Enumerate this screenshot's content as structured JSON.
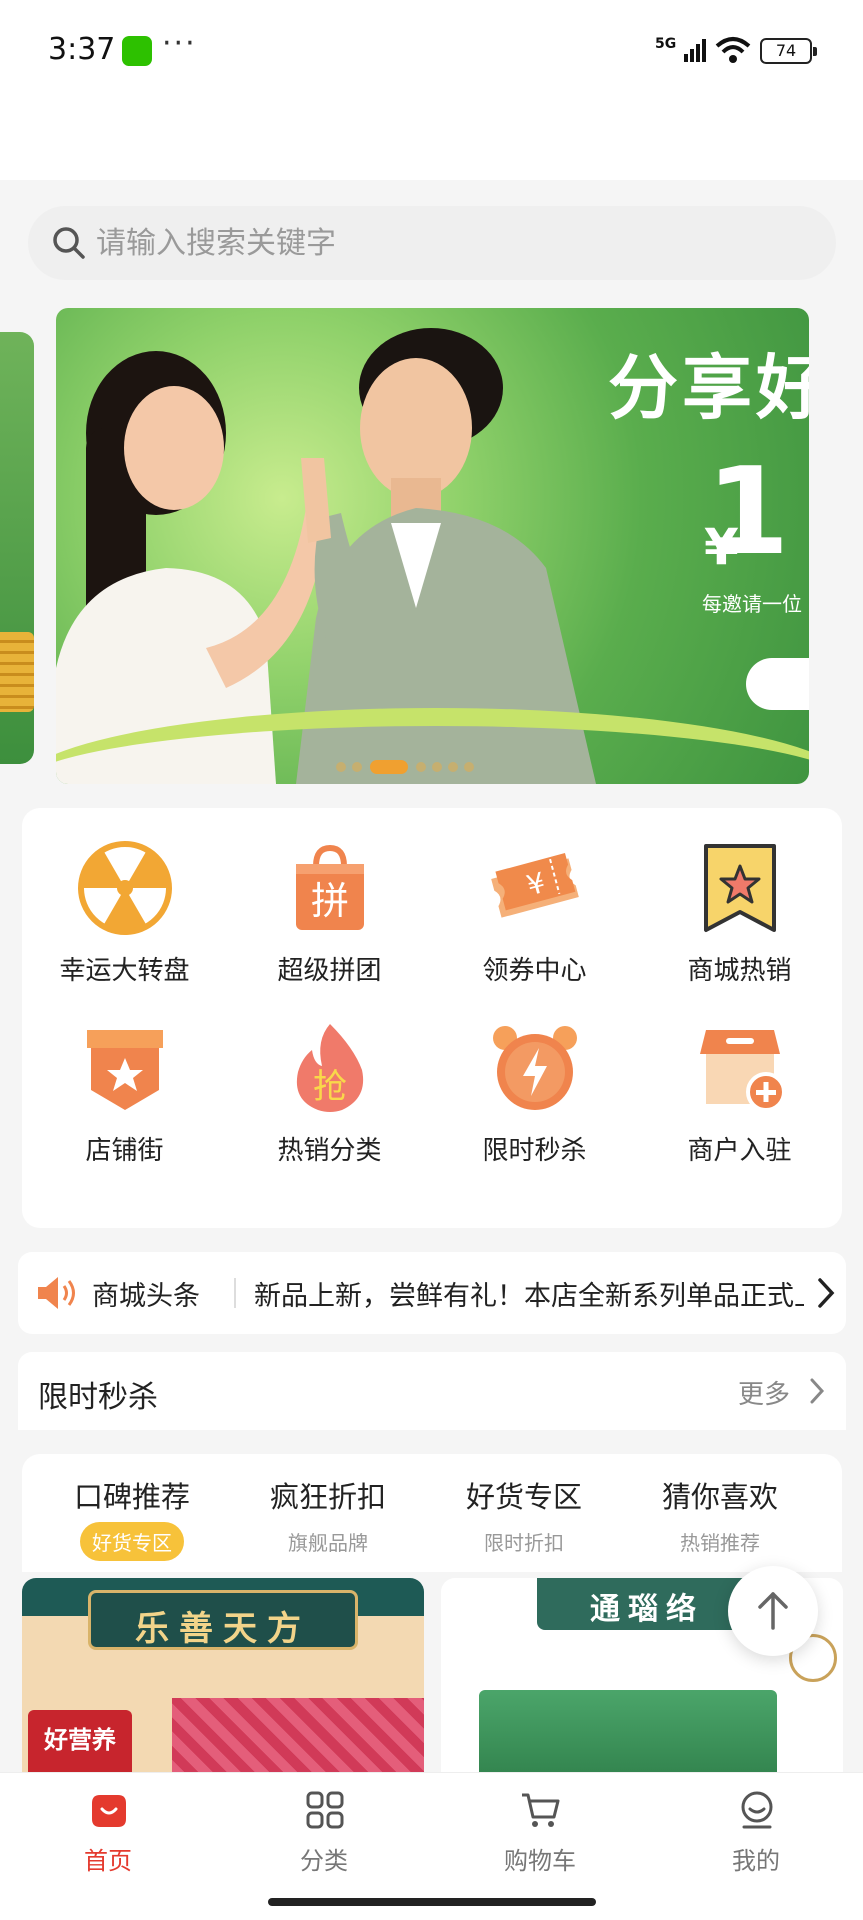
{
  "status_bar": {
    "time": "3:37",
    "network": "5G",
    "battery": "74",
    "more": "···"
  },
  "search": {
    "placeholder": "请输入搜索关键字"
  },
  "banner": {
    "title": "分享好",
    "amount": "1",
    "currency": "¥",
    "subtitle": "每邀请一位"
  },
  "grid": {
    "items": [
      {
        "label": "幸运大转盘",
        "icon": "wheel-icon"
      },
      {
        "label": "超级拼团",
        "icon": "group-buy-icon"
      },
      {
        "label": "领券中心",
        "icon": "coupon-icon"
      },
      {
        "label": "商城热销",
        "icon": "hot-sale-icon"
      },
      {
        "label": "店铺街",
        "icon": "store-street-icon"
      },
      {
        "label": "热销分类",
        "icon": "hot-category-icon"
      },
      {
        "label": "限时秒杀",
        "icon": "flash-sale-icon"
      },
      {
        "label": "商户入驻",
        "icon": "merchant-join-icon"
      }
    ],
    "badge_grab": "抢",
    "badge_pin": "拼"
  },
  "notice": {
    "title": "商城头条",
    "text": "新品上新，尝鲜有礼！本店全新系列单品正式上线"
  },
  "flash_sale": {
    "title": "限时秒杀",
    "more": "更多"
  },
  "tabs": [
    {
      "title": "口碑推荐",
      "sub": "好货专区",
      "active": true
    },
    {
      "title": "疯狂折扣",
      "sub": "旗舰品牌",
      "active": false
    },
    {
      "title": "好货专区",
      "sub": "限时折扣",
      "active": false
    },
    {
      "title": "猜你喜欢",
      "sub": "热销推荐",
      "active": false
    }
  ],
  "products": [
    {
      "brand": "乐善天方",
      "tag": "好营养"
    },
    {
      "brand": "通瑙络"
    }
  ],
  "bottom_nav": [
    {
      "label": "首页",
      "icon": "home-icon",
      "active": true
    },
    {
      "label": "分类",
      "icon": "category-icon",
      "active": false
    },
    {
      "label": "购物车",
      "icon": "cart-icon",
      "active": false
    },
    {
      "label": "我的",
      "icon": "profile-icon",
      "active": false
    }
  ],
  "colors": {
    "accent": "#e43a2e",
    "banner_green": "#5aad4d",
    "tab_badge": "#f7c23a",
    "icon_orange": "#f08a4b"
  }
}
